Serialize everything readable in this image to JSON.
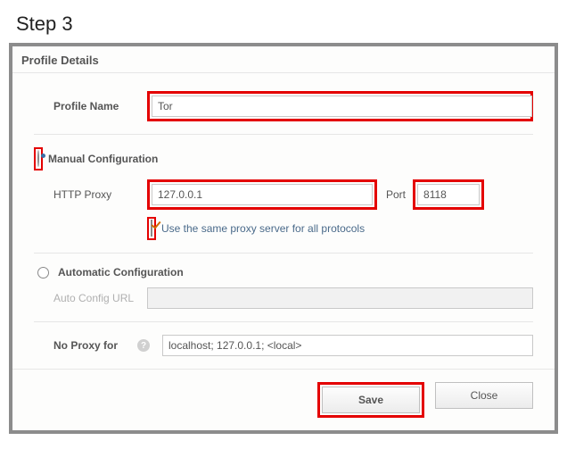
{
  "step_title": "Step 3",
  "panel_title": "Profile Details",
  "profile": {
    "name_label": "Profile Name",
    "name_value": "Tor"
  },
  "manual": {
    "label": "Manual Configuration",
    "http_proxy_label": "HTTP Proxy",
    "http_proxy_value": "127.0.0.1",
    "port_label": "Port",
    "port_value": "8118",
    "same_proxy_label": "Use the same proxy server for all protocols"
  },
  "automatic": {
    "label": "Automatic Configuration",
    "url_label": "Auto Config URL",
    "url_value": ""
  },
  "noproxy": {
    "label": "No Proxy for",
    "value": "localhost; 127.0.0.1; <local>"
  },
  "buttons": {
    "save": "Save",
    "close": "Close"
  }
}
